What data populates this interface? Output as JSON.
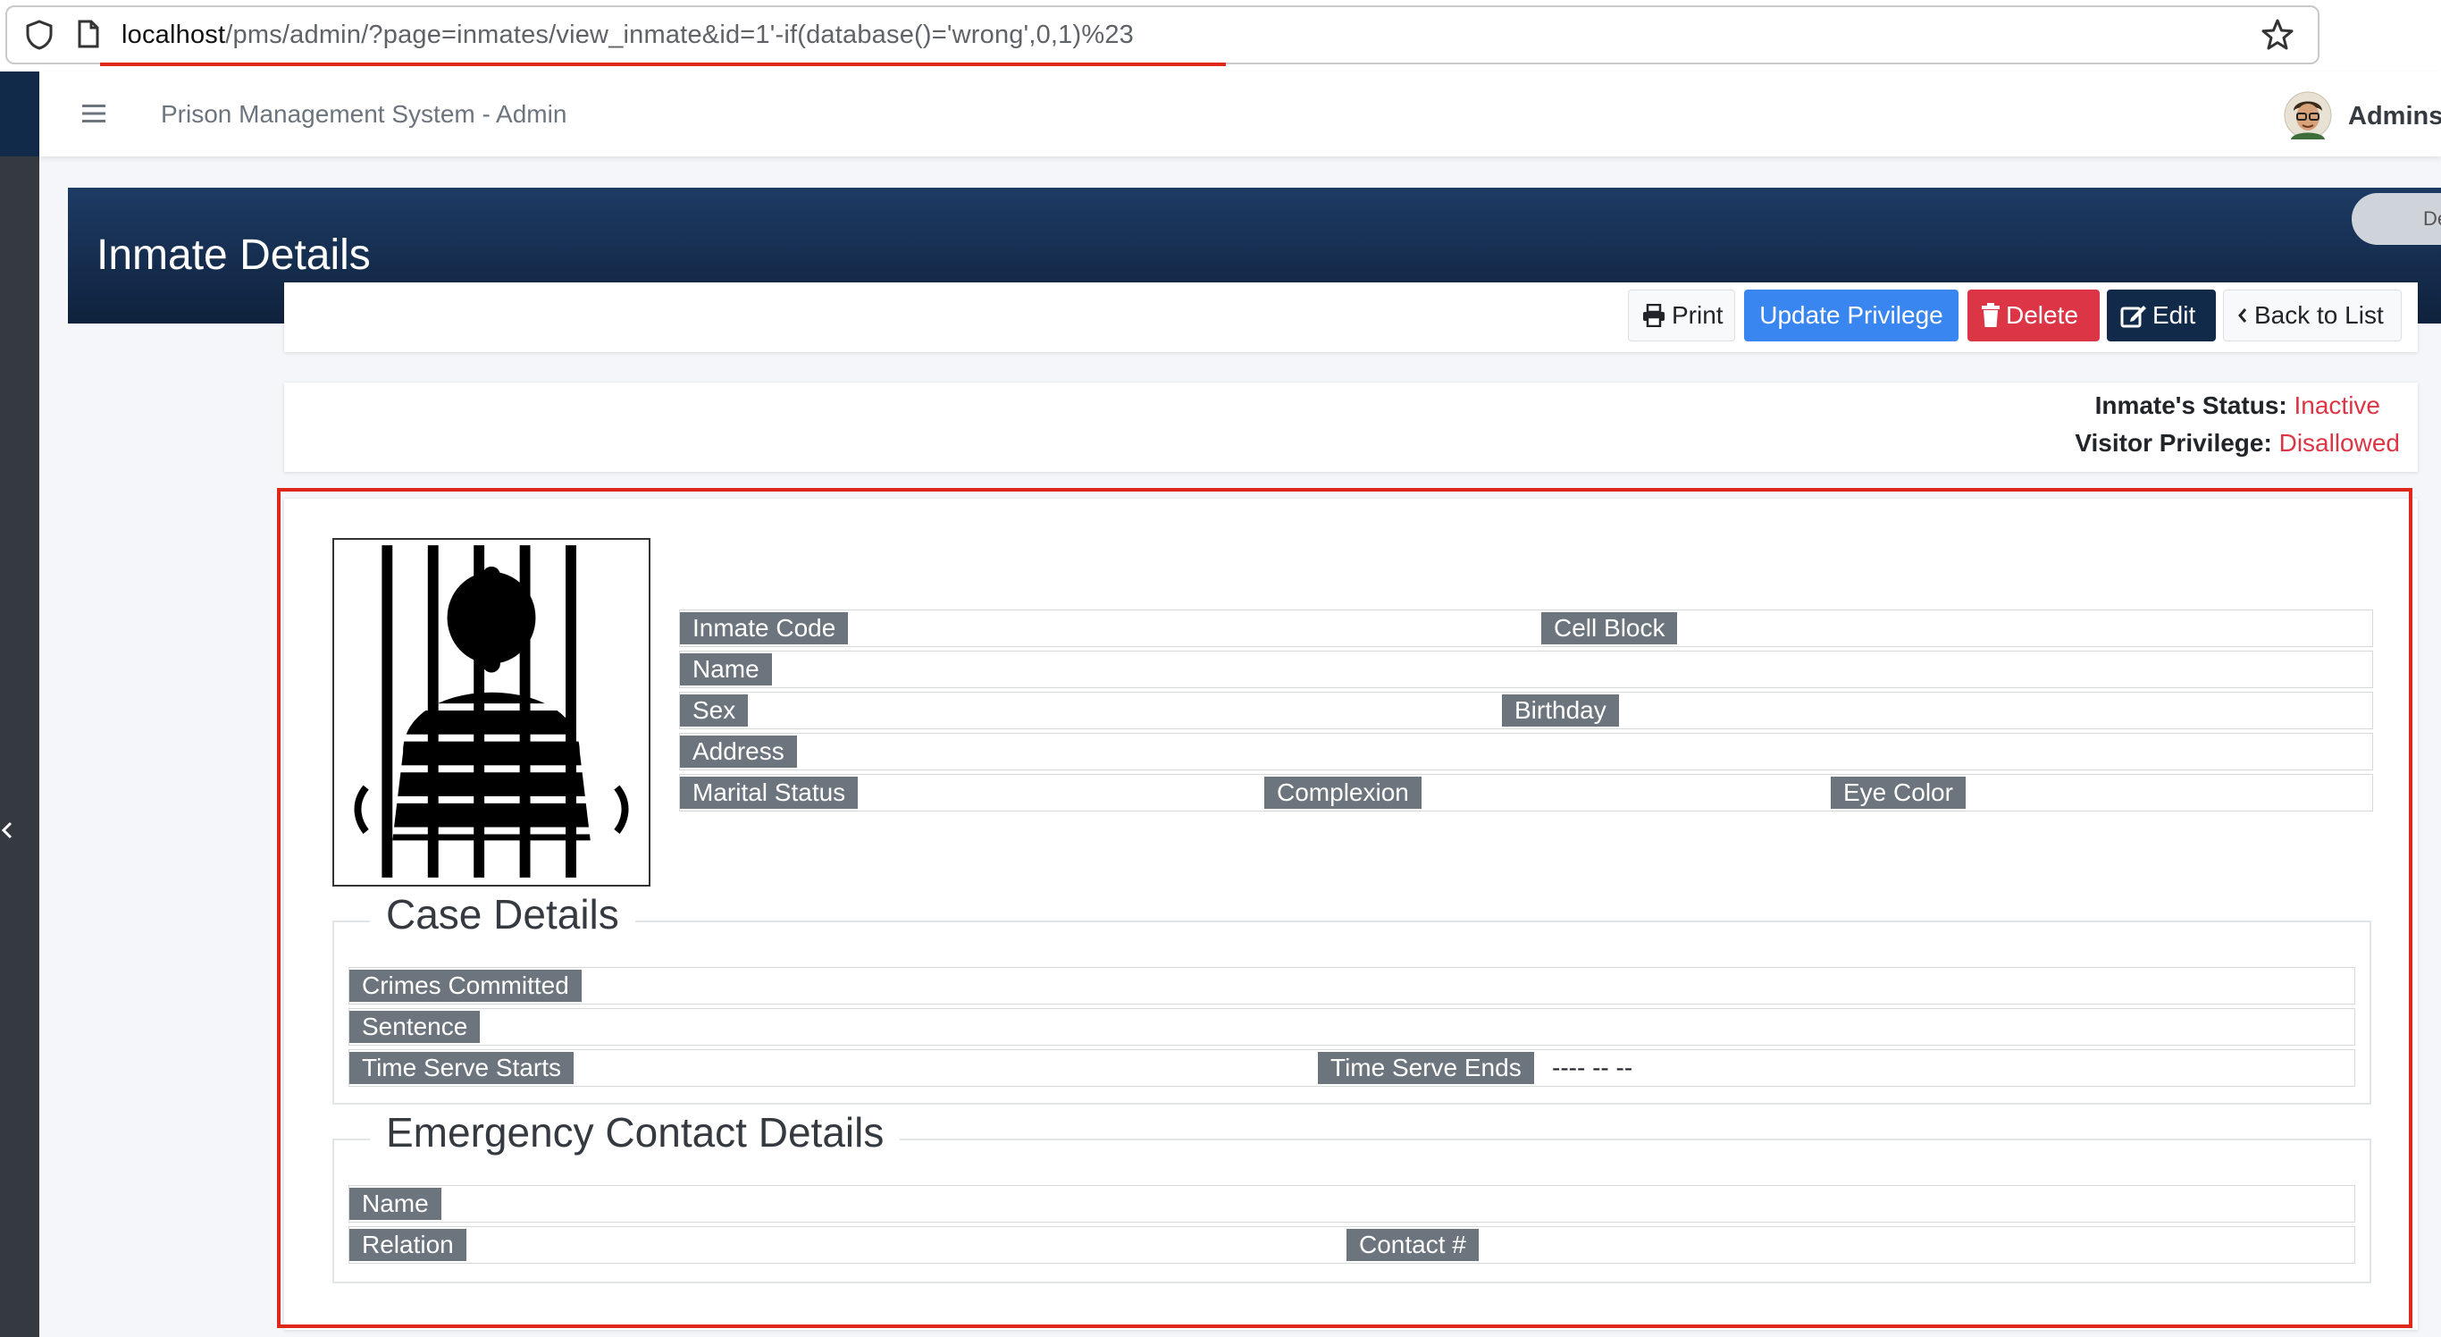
{
  "browser": {
    "url_host": "localhost",
    "url_path": "/pms/admin/?page=inmates/view_inmate&id=1'-if(database()='wrong',0,1)%23"
  },
  "navbar": {
    "title": "Prison Management System - Admin",
    "user": "Admins"
  },
  "header": {
    "title": "Inmate Details",
    "dev_label": "Dev"
  },
  "toolbar": {
    "print": "Print",
    "update_privilege": "Update Privilege",
    "delete": "Delete",
    "edit": "Edit",
    "back": "Back to List"
  },
  "status": {
    "status_label": "Inmate's Status:",
    "status_value": "Inactive",
    "privilege_label": "Visitor Privilege:",
    "privilege_value": "Disallowed"
  },
  "inmate": {
    "code_label": "Inmate Code",
    "code": "",
    "cell_block_label": "Cell Block",
    "cell_block": "",
    "name_label": "Name",
    "name": "",
    "sex_label": "Sex",
    "sex": "",
    "birthday_label": "Birthday",
    "birthday": "",
    "address_label": "Address",
    "address": "",
    "marital_label": "Marital Status",
    "marital": "",
    "complexion_label": "Complexion",
    "complexion": "",
    "eye_color_label": "Eye Color",
    "eye_color": ""
  },
  "case": {
    "title": "Case Details",
    "crimes_label": "Crimes Committed",
    "crimes": "",
    "sentence_label": "Sentence",
    "sentence": "",
    "starts_label": "Time Serve Starts",
    "starts": "",
    "ends_label": "Time Serve Ends",
    "ends": "---- -- --"
  },
  "emergency": {
    "title": "Emergency Contact Details",
    "name_label": "Name",
    "name": "",
    "relation_label": "Relation",
    "relation": "",
    "contact_label": "Contact #",
    "contact": ""
  },
  "colors": {
    "primary": "#3a86f0",
    "danger": "#dc3545",
    "navy": "#122a4a",
    "label_gray": "#6c757d",
    "highlight": "#e0271b"
  },
  "icons": [
    "shield-icon",
    "page-icon",
    "star-icon",
    "menu-icon",
    "print-icon",
    "trash-icon",
    "edit-icon",
    "chevron-left-icon",
    "sidebar-toggle-icon"
  ]
}
